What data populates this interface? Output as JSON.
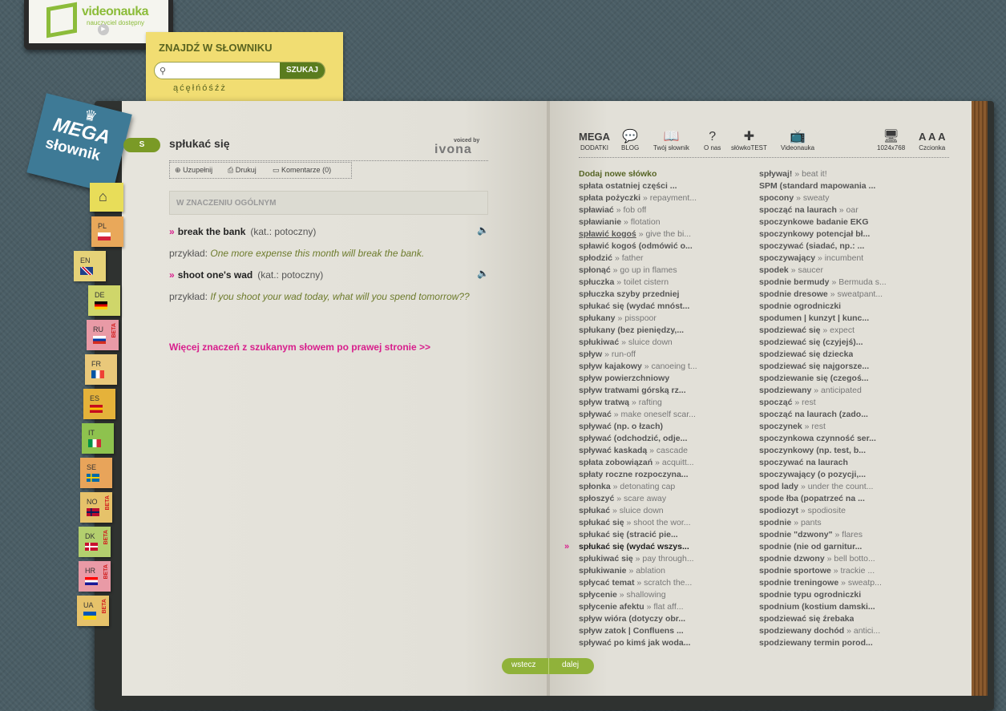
{
  "logo": {
    "brand": "videonauka",
    "tagline": "nauczyciel dostępny"
  },
  "search": {
    "title": "ZNAJDŹ W SŁOWNIKU",
    "button": "SZUKAJ",
    "placeholder": "",
    "special_chars": "ąćęłńóśźż"
  },
  "mega": {
    "line1": "MEGA",
    "line2": "słownik"
  },
  "langs": [
    {
      "code": "PL",
      "beta": ""
    },
    {
      "code": "EN",
      "beta": ""
    },
    {
      "code": "DE",
      "beta": ""
    },
    {
      "code": "RU",
      "beta": "BETA"
    },
    {
      "code": "FR",
      "beta": ""
    },
    {
      "code": "ES",
      "beta": ""
    },
    {
      "code": "IT",
      "beta": ""
    },
    {
      "code": "SE",
      "beta": ""
    },
    {
      "code": "NO",
      "beta": "BETA"
    },
    {
      "code": "DK",
      "beta": "BETA"
    },
    {
      "code": "HR",
      "beta": "BETA"
    },
    {
      "code": "UA",
      "beta": "BETA"
    }
  ],
  "entry": {
    "letter": "S",
    "headword": "spłukać się",
    "voiced_by": "voiced by",
    "voice_brand": "ivona",
    "actions": {
      "complete": "Uzupełnij",
      "print": "Drukuj",
      "comments": "Komentarze",
      "comments_count": "(0)"
    },
    "section": "W ZNACZENIU OGÓLNYM",
    "example_label": "przykład:",
    "senses": [
      {
        "arrow": "»",
        "word": "break the bank",
        "cat": "(kat.: potoczny)",
        "example": "One more expense this month will break the bank."
      },
      {
        "arrow": "»",
        "word": "shoot one's wad",
        "cat": "(kat.: potoczny)",
        "example": "If you shoot your wad today, what will you spend tomorrow??"
      }
    ],
    "more_link": "Więcej znaczeń z szukanym słowem po prawej stronie >>"
  },
  "nav": [
    {
      "label": "DODATKI",
      "top": "MEGA",
      "icon": "crown-icon"
    },
    {
      "label": "BLOG",
      "icon": "chat-icon"
    },
    {
      "label": "Twój słownik",
      "icon": "book-icon"
    },
    {
      "label": "O nas",
      "icon": "question-icon"
    },
    {
      "label": "słówkoTEST",
      "icon": "puzzle-icon"
    },
    {
      "label": "Videonauka",
      "icon": "tv-icon"
    },
    {
      "label": "1024x768",
      "icon": "monitor-icon"
    },
    {
      "label": "Czcionka",
      "top": "A A A",
      "icon": "font-size-icon"
    }
  ],
  "word_list": {
    "left": [
      {
        "hw": "Dodaj nowe słówko",
        "tr": ""
      },
      {
        "hw": "spłata ostatniej części ...",
        "tr": ""
      },
      {
        "hw": "spłata pożyczki",
        "tr": "» repayment..."
      },
      {
        "hw": "spławiać",
        "tr": "» fob off"
      },
      {
        "hw": "spławianie",
        "tr": "» flotation"
      },
      {
        "hw": "spławić kogoś",
        "tr": "» give the bi..."
      },
      {
        "hw": "spławić kogoś (odmówić o...",
        "tr": ""
      },
      {
        "hw": "spłodzić",
        "tr": "» father"
      },
      {
        "hw": "spłonąć",
        "tr": "» go up in flames"
      },
      {
        "hw": "spłuczka",
        "tr": "» toilet cistern"
      },
      {
        "hw": "spłuczka szyby przedniej",
        "tr": ""
      },
      {
        "hw": "spłukać się (wydać mnóst...",
        "tr": ""
      },
      {
        "hw": "spłukany",
        "tr": "» pisspoor"
      },
      {
        "hw": "spłukany (bez pieniędzy,...",
        "tr": ""
      },
      {
        "hw": "spłukiwać",
        "tr": "» sluice down"
      },
      {
        "hw": "spływ",
        "tr": "» run-off"
      },
      {
        "hw": "spływ kajakowy",
        "tr": "» canoeing t..."
      },
      {
        "hw": "spływ powierzchniowy",
        "tr": ""
      },
      {
        "hw": "spływ tratwami górską rz...",
        "tr": ""
      },
      {
        "hw": "spływ tratwą",
        "tr": "» rafting"
      },
      {
        "hw": "spływać",
        "tr": "» make oneself scar..."
      },
      {
        "hw": "spływać (np. o łzach)",
        "tr": ""
      },
      {
        "hw": "spływać (odchodzić, odje...",
        "tr": ""
      },
      {
        "hw": "spływać kaskadą",
        "tr": "» cascade"
      },
      {
        "hw": "spłata zobowiązań",
        "tr": "» acquitt..."
      },
      {
        "hw": "spłaty roczne rozpoczyna...",
        "tr": ""
      },
      {
        "hw": "spłonka",
        "tr": "» detonating cap"
      },
      {
        "hw": "spłoszyć",
        "tr": "» scare away"
      },
      {
        "hw": "spłukać",
        "tr": "» sluice down"
      },
      {
        "hw": "spłukać się",
        "tr": "» shoot the wor..."
      },
      {
        "hw": "spłukać się (stracić pie...",
        "tr": ""
      },
      {
        "hw": "spłukać się (wydać wszys...",
        "tr": ""
      },
      {
        "hw": "spłukiwać się",
        "tr": "» pay through..."
      },
      {
        "hw": "spłukiwanie",
        "tr": "» ablation"
      },
      {
        "hw": "spłycać temat",
        "tr": "» scratch the..."
      },
      {
        "hw": "spłycenie",
        "tr": "» shallowing"
      },
      {
        "hw": "spłycenie afektu",
        "tr": "» flat aff..."
      },
      {
        "hw": "spływ wióra (dotyczy obr...",
        "tr": ""
      },
      {
        "hw": "spływ zatok | Confluens ...",
        "tr": ""
      },
      {
        "hw": "spływać po kimś jak woda...",
        "tr": ""
      }
    ],
    "right": [
      {
        "hw": "spływaj!",
        "tr": "» beat it!"
      },
      {
        "hw": "SPM (standard mapowania ...",
        "tr": ""
      },
      {
        "hw": "spocony",
        "tr": "» sweaty"
      },
      {
        "hw": "spocząć na laurach",
        "tr": "» oar"
      },
      {
        "hw": "spoczynkowe badanie EKG",
        "tr": ""
      },
      {
        "hw": "spoczynkowy potencjał bł...",
        "tr": ""
      },
      {
        "hw": "spoczywać (siadać, np.: ...",
        "tr": ""
      },
      {
        "hw": "spoczywający",
        "tr": "» incumbent"
      },
      {
        "hw": "spodek",
        "tr": "» saucer"
      },
      {
        "hw": "spodnie bermudy",
        "tr": "» Bermuda s..."
      },
      {
        "hw": "spodnie dresowe",
        "tr": "» sweatpant..."
      },
      {
        "hw": "spodnie ogrodniczki",
        "tr": ""
      },
      {
        "hw": "spodumen | kunzyt | kunc...",
        "tr": ""
      },
      {
        "hw": "spodziewać się",
        "tr": "» expect"
      },
      {
        "hw": "spodziewać się (czyjejś)...",
        "tr": ""
      },
      {
        "hw": "spodziewać się dziecka",
        "tr": ""
      },
      {
        "hw": "spodziewać się najgorsze...",
        "tr": ""
      },
      {
        "hw": "spodziewanie się (czegoś...",
        "tr": ""
      },
      {
        "hw": "spodziewany",
        "tr": "» anticipated"
      },
      {
        "hw": "spocząć",
        "tr": "» rest"
      },
      {
        "hw": "spocząć na laurach (zado...",
        "tr": ""
      },
      {
        "hw": "spoczynek",
        "tr": "» rest"
      },
      {
        "hw": "spoczynkowa czynność ser...",
        "tr": ""
      },
      {
        "hw": "spoczynkowy (np. test, b...",
        "tr": ""
      },
      {
        "hw": "spoczywać na laurach",
        "tr": ""
      },
      {
        "hw": "spoczywający (o pozycji,...",
        "tr": ""
      },
      {
        "hw": "spod lady",
        "tr": "» under the count..."
      },
      {
        "hw": "spode łba (popatrzeć na ...",
        "tr": ""
      },
      {
        "hw": "spodiozyt",
        "tr": "» spodiosite"
      },
      {
        "hw": "spodnie",
        "tr": "» pants"
      },
      {
        "hw": "spodnie \"dzwony\"",
        "tr": "» flares"
      },
      {
        "hw": "spodnie (nie od garnitur...",
        "tr": ""
      },
      {
        "hw": "spodnie dzwony",
        "tr": "» bell botto..."
      },
      {
        "hw": "spodnie sportowe",
        "tr": "» trackie ..."
      },
      {
        "hw": "spodnie treningowe",
        "tr": "» sweatp..."
      },
      {
        "hw": "spodnie typu ogrodniczki",
        "tr": ""
      },
      {
        "hw": "spodnium (kostium damski...",
        "tr": ""
      },
      {
        "hw": "spodziewać się źrebaka",
        "tr": ""
      },
      {
        "hw": "spodziewany dochód",
        "tr": "» antici..."
      },
      {
        "hw": "spodziewany termin porod...",
        "tr": ""
      }
    ]
  },
  "current_marker": "»",
  "pager": {
    "prev": "wstecz",
    "next": "dalej"
  }
}
